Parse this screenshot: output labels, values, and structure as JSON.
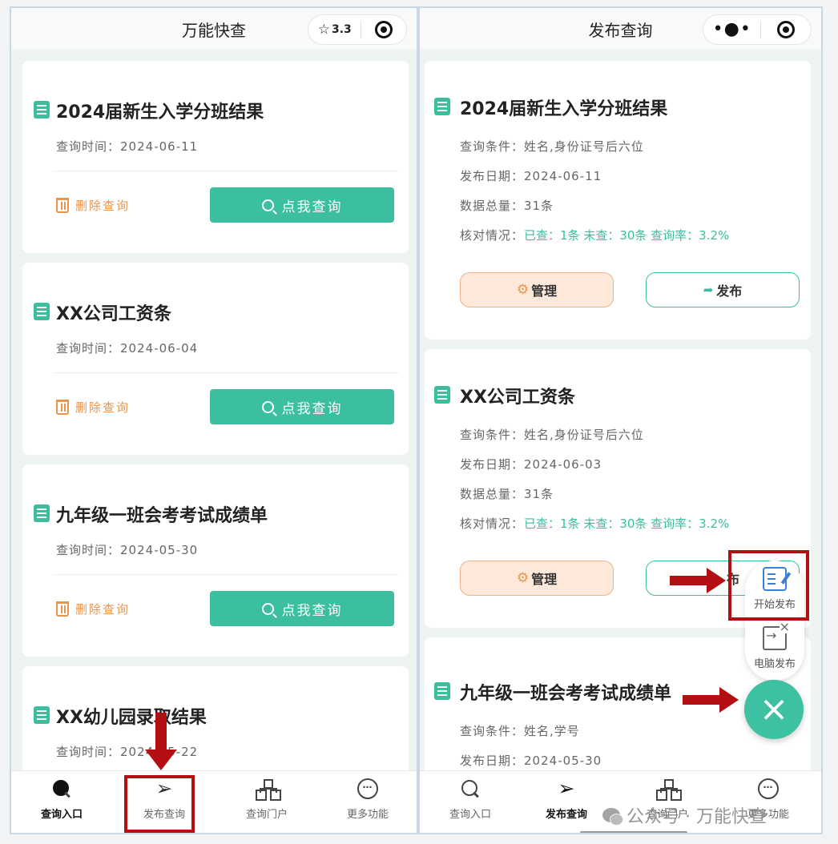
{
  "left": {
    "title": "万能快查",
    "capsule": {
      "rating": "3.3",
      "star_icon": "star-icon",
      "target_icon": "target-icon"
    },
    "cards": [
      {
        "title": "2024届新生入学分班结果",
        "time_label": "查询时间：",
        "time": "2024-06-11",
        "delete_label": "删除查询",
        "query_label": "点我查询"
      },
      {
        "title": "XX公司工资条",
        "time_label": "查询时间：",
        "time": "2024-06-04",
        "delete_label": "删除查询",
        "query_label": "点我查询"
      },
      {
        "title": "九年级一班会考考试成绩单",
        "time_label": "查询时间：",
        "time": "2024-05-30",
        "delete_label": "删除查询",
        "query_label": "点我查询"
      },
      {
        "title": "XX幼儿园录取结果",
        "time_label": "查询时间：",
        "time": "2024-05-22"
      }
    ],
    "tabs": [
      {
        "label": "查询入口",
        "icon": "search-icon",
        "active": true
      },
      {
        "label": "发布查询",
        "icon": "send-icon",
        "active": false
      },
      {
        "label": "查询门户",
        "icon": "org-icon",
        "active": false
      },
      {
        "label": "更多功能",
        "icon": "more-icon",
        "active": false
      }
    ]
  },
  "right": {
    "title": "发布查询",
    "capsule": {
      "dots": "•●•",
      "dots_icon": "more-dots-icon",
      "target_icon": "target-icon"
    },
    "cards": [
      {
        "title": "2024届新生入学分班结果",
        "cond_label": "查询条件：",
        "cond": "姓名,身份证号后六位",
        "date_label": "发布日期：",
        "date": "2024-06-11",
        "total_label": "数据总量：",
        "total": "31条",
        "check_label": "核对情况：",
        "check_stats": "已查：1条 未查：30条 查询率：3.2%",
        "manage_label": "管理",
        "publish_label": "发布"
      },
      {
        "title": "XX公司工资条",
        "cond_label": "查询条件：",
        "cond": "姓名,身份证号后六位",
        "date_label": "发布日期：",
        "date": "2024-06-03",
        "total_label": "数据总量：",
        "total": "31条",
        "check_label": "核对情况：",
        "check_stats": "已查：1条 未查：30条 查询率：3.2%",
        "manage_label": "管理",
        "publish_label": "布"
      },
      {
        "title": "九年级一班会考考试成绩单",
        "cond_label": "查询条件：",
        "cond": "姓名,学号",
        "date_label": "发布日期：",
        "date": "2024-05-30"
      }
    ],
    "fab": {
      "start_publish": "开始发布",
      "pc_publish": "电脑发布",
      "close": "×"
    },
    "tabs": [
      {
        "label": "查询入口",
        "icon": "search-icon",
        "active": false
      },
      {
        "label": "发布查询",
        "icon": "send-icon",
        "active": true
      },
      {
        "label": "查询门户",
        "icon": "org-icon",
        "active": false
      },
      {
        "label": "更多功能",
        "icon": "more-icon",
        "active": false
      }
    ]
  },
  "glyphs": {
    "star": "☆",
    "gear": "⚙",
    "share": "➦",
    "send": "➢",
    "more": "⋯"
  },
  "watermark": "公众号 · 万能快查",
  "colors": {
    "accent": "#3bbd9e",
    "orange": "#e8954e",
    "annotation_red": "#b30e12"
  }
}
